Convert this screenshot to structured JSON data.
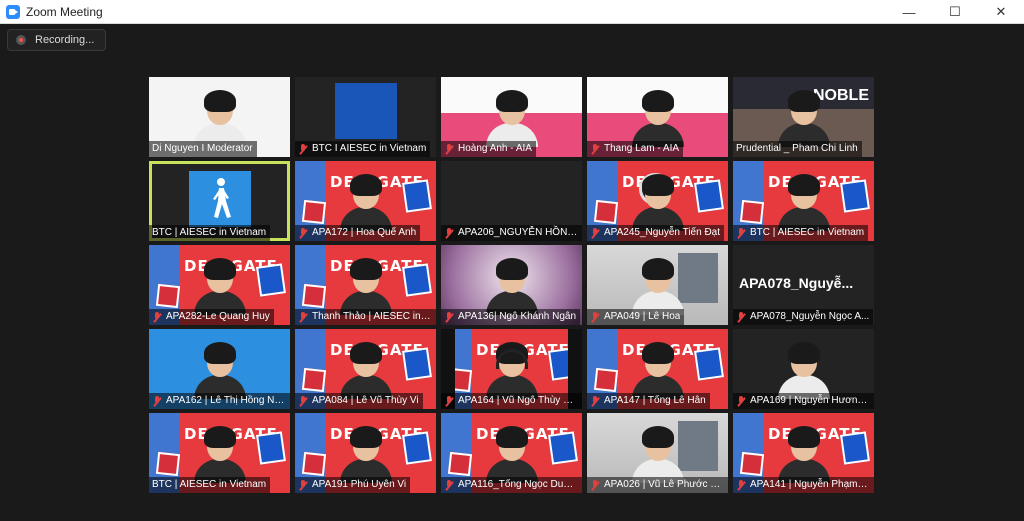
{
  "window": {
    "title": "Zoom Meeting",
    "minimize": "—",
    "maximize": "☐",
    "close": "✕"
  },
  "recording": {
    "label": "Recording..."
  },
  "colors": {
    "accent_active": "#c8e35b",
    "muted_mic": "#e04040",
    "zoom_blue": "#2d8cff"
  },
  "tiles": [
    {
      "name": "Di Nguyen I Moderator",
      "muted": false,
      "bg": "bg-white",
      "person": "light"
    },
    {
      "name": "BTC I AIESEC in Vietnam",
      "muted": true,
      "bg": "bg-dark",
      "person": ""
    },
    {
      "name": "Hoàng Anh - AIA",
      "muted": true,
      "bg": "bg-pink",
      "person": "light"
    },
    {
      "name": "Thang Lam - AIA",
      "muted": true,
      "bg": "bg-pink",
      "person": ""
    },
    {
      "name": "Prudential _ Pham Chi Linh",
      "muted": false,
      "bg": "bg-city",
      "person": ""
    },
    {
      "name": "BTC | AIESEC in Vietnam",
      "muted": false,
      "bg": "bg-dark",
      "person": ""
    },
    {
      "name": "APA172 | Hoa Quế Anh",
      "muted": true,
      "bg": "bg-red",
      "person": ""
    },
    {
      "name": "APA206_NGUYỄN HỒNG ...",
      "muted": true,
      "bg": "bg-dark",
      "person": ""
    },
    {
      "name": "APA245_Nguyễn Tiến Đạt",
      "muted": true,
      "bg": "bg-red",
      "person": ""
    },
    {
      "name": "BTC | AIESEC in Vietnam",
      "muted": true,
      "bg": "bg-red",
      "person": ""
    },
    {
      "name": "APA282-Le Quang Huy",
      "muted": true,
      "bg": "bg-red",
      "person": ""
    },
    {
      "name": "Thanh Thảo | AIESEC in V...",
      "muted": true,
      "bg": "bg-red",
      "person": ""
    },
    {
      "name": "APA136| Ngô Khánh Ngân",
      "muted": true,
      "bg": "bg-purple",
      "person": ""
    },
    {
      "name": "APA049 | Lê Hoa",
      "muted": true,
      "bg": "bg-room",
      "person": "light"
    },
    {
      "name": "APA078_Nguyễn Ngọc A...",
      "muted": true,
      "bg": "bg-dark",
      "person": ""
    },
    {
      "name": "APA162 | Lê Thị Hồng Nh...",
      "muted": true,
      "bg": "bg-blue",
      "person": ""
    },
    {
      "name": "APA084 | Lê Vũ Thùy Vi",
      "muted": true,
      "bg": "bg-red",
      "person": ""
    },
    {
      "name": "APA164 | Vũ Ngô Thùy N...",
      "muted": true,
      "bg": "bg-red",
      "person": ""
    },
    {
      "name": "APA147 | Tống Lê Hân",
      "muted": true,
      "bg": "bg-red",
      "person": ""
    },
    {
      "name": "APA169 | Nguyễn Hương ...",
      "muted": true,
      "bg": "bg-dark",
      "person": "light"
    },
    {
      "name": "BTC | AIESEC in Vietnam",
      "muted": false,
      "bg": "bg-red",
      "person": ""
    },
    {
      "name": "APA191 Phú Uyên Vi",
      "muted": true,
      "bg": "bg-red",
      "person": ""
    },
    {
      "name": "APA116_Tống Ngọc Duyê...",
      "muted": true,
      "bg": "bg-red",
      "person": ""
    },
    {
      "name": "APA026 | Vũ Lê Phước Qu...",
      "muted": true,
      "bg": "bg-room",
      "person": "light"
    },
    {
      "name": "APA141 | Nguyễn Phạm T...",
      "muted": true,
      "bg": "bg-red",
      "person": ""
    }
  ],
  "tile_extra": {
    "banner_text": "DELEGATE",
    "big_name_078": "APA078_Nguyễ...",
    "city_sign": "NOBLE"
  }
}
